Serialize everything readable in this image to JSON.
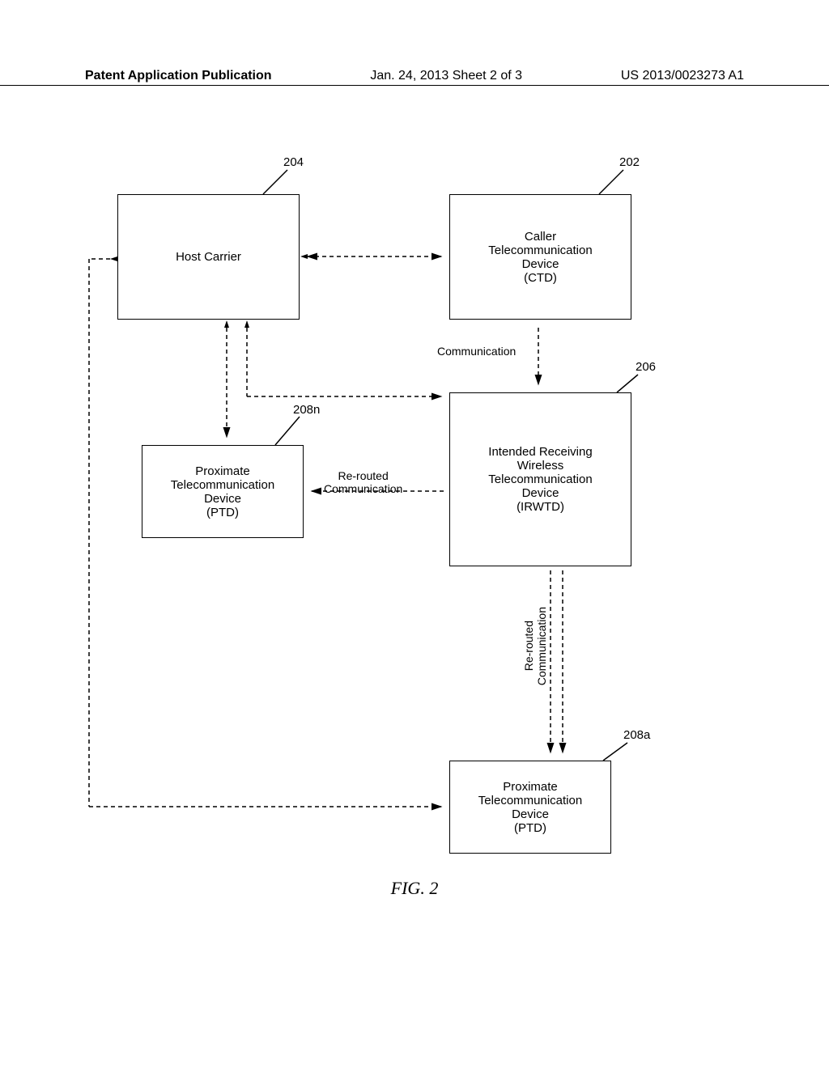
{
  "header": {
    "left": "Patent Application Publication",
    "center": "Jan. 24, 2013  Sheet 2 of 3",
    "right": "US 2013/0023273 A1"
  },
  "refs": {
    "r204": "204",
    "r202": "202",
    "r208n": "208n",
    "r206": "206",
    "r208a": "208a"
  },
  "boxes": {
    "host": "Host Carrier",
    "ctd": "Caller\nTelecommunication\nDevice\n(CTD)",
    "irwtd": "Intended Receiving\nWireless\nTelecommunication\nDevice\n(IRWTD)",
    "ptd_n": "Proximate\nTelecommunication\nDevice\n(PTD)",
    "ptd_a": "Proximate\nTelecommunication\nDevice\n(PTD)"
  },
  "labels": {
    "communication": "Communication",
    "rerouted_comm_1": "Re-routed\nCommunication",
    "rerouted_comm_2": "Re-routed\nCommunication"
  },
  "figure_caption": "FIG. 2"
}
